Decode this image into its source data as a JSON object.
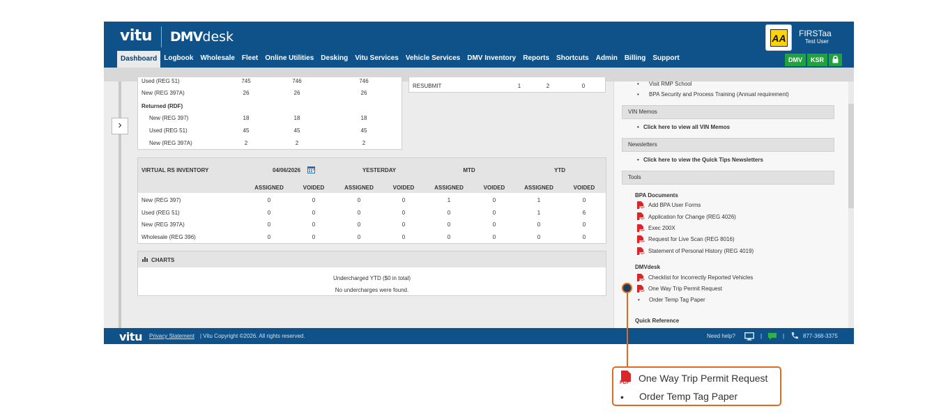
{
  "header": {
    "logo_vitu": "vitu",
    "logo_dmv_bold": "DMV",
    "logo_dmv_rest": "desk",
    "badge_text": "AA",
    "user_name": "FIRSTaa",
    "user_role": "Test User"
  },
  "nav": [
    "Dashboard",
    "Logbook",
    "Wholesale",
    "Fleet",
    "Online Utilities",
    "Desking",
    "Vitu Services",
    "Vehicle Services",
    "DMV Inventory",
    "Reports",
    "Shortcuts",
    "Admin",
    "Billing",
    "Support"
  ],
  "env_buttons": [
    "DMV",
    "KSR"
  ],
  "top_table": {
    "rows": [
      {
        "label": "Used (REG 51)",
        "v": [
          "745",
          "746",
          "746"
        ]
      },
      {
        "label": "New (REG 397A)",
        "v": [
          "26",
          "26",
          "26"
        ]
      }
    ],
    "returned_label": "Returned (RDF)",
    "returned_rows": [
      {
        "label": "New (REG 397)",
        "v": [
          "18",
          "18",
          "18"
        ]
      },
      {
        "label": "Used (REG 51)",
        "v": [
          "45",
          "45",
          "45"
        ]
      },
      {
        "label": "New (REG 397A)",
        "v": [
          "2",
          "2",
          "2"
        ]
      }
    ]
  },
  "resubmit": {
    "label": "RESUBMIT",
    "v": [
      "1",
      "2",
      "0"
    ]
  },
  "virtual_rs": {
    "title": "VIRTUAL RS INVENTORY",
    "date": "04/06/2026",
    "groups": [
      "YESTERDAY",
      "MTD",
      "YTD"
    ],
    "cols": [
      "ASSIGNED",
      "VOIDED",
      "ASSIGNED",
      "VOIDED",
      "ASSIGNED",
      "VOIDED",
      "ASSIGNED",
      "VOIDED"
    ],
    "rows": [
      {
        "label": "New (REG 397)",
        "v": [
          "0",
          "0",
          "0",
          "0",
          "1",
          "0",
          "1",
          "0"
        ]
      },
      {
        "label": "Used (REG 51)",
        "v": [
          "0",
          "0",
          "0",
          "0",
          "0",
          "0",
          "1",
          "6"
        ]
      },
      {
        "label": "New (REG 397A)",
        "v": [
          "0",
          "0",
          "0",
          "0",
          "0",
          "0",
          "0",
          "0"
        ]
      },
      {
        "label": "Wholesale (REG 396)",
        "v": [
          "0",
          "0",
          "0",
          "0",
          "0",
          "0",
          "0",
          "0"
        ]
      }
    ]
  },
  "charts": {
    "title": "CHARTS",
    "line1": "Undercharged YTD ($0 in total)",
    "line2": "No undercharges were found."
  },
  "right": {
    "bullets_top": [
      "Visit RMP School",
      "BPA Security and Process Training (Annual requirement)"
    ],
    "vin_memos": {
      "title": "VIN Memos",
      "link": "Click here to view all VIN Memos"
    },
    "newsletters": {
      "title": "Newsletters",
      "link": "Click here to view the Quick Tips Newsletters"
    },
    "tools": {
      "title": "Tools",
      "bpa_title": "BPA Documents",
      "bpa_docs": [
        "Add BPA User Forms",
        "Application for Change (REG 4026)",
        "Exec 200X",
        "Request for Live Scan (REG 8016)",
        "Statement of Personal History (REG 4019)"
      ],
      "dmvdesk_title": "DMVdesk",
      "dmvdesk_docs": [
        "Checklist for Incorrectly Reported Vehicles",
        "One Way Trip Permit Request"
      ],
      "dmvdesk_bullet": "Order Temp Tag Paper",
      "quick_ref_title": "Quick Reference"
    }
  },
  "footer": {
    "logo": "vitu",
    "privacy": "Privacy Statement",
    "copyright": "| Vitu Copyright ©2026. All rights reserved.",
    "need_help": "Need help?",
    "phone": "877-368-3375"
  },
  "callout": {
    "item1": "One Way Trip Permit Request",
    "item2": "Order Temp Tag Paper",
    "pdf_tag": "PDF"
  },
  "colors": {
    "brand": "#0f5289",
    "accent": "#e26a1e",
    "env_green": "#1fa33c",
    "pdf_red": "#d9262a"
  }
}
